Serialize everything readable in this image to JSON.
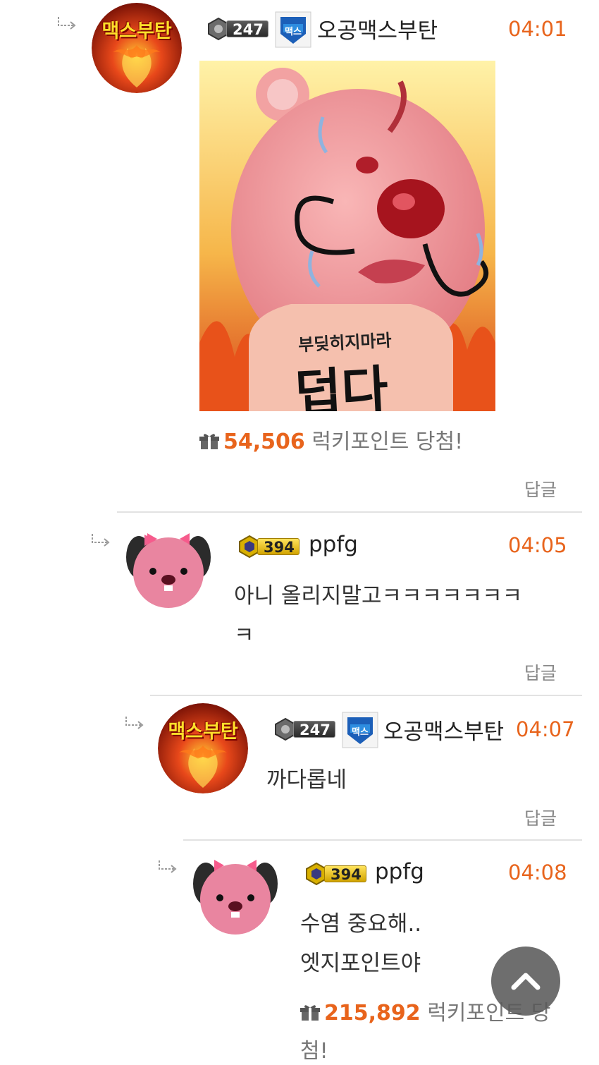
{
  "comments": [
    {
      "level": "247",
      "nickname": "오공맥스부탄",
      "time": "04:01",
      "avatar_text": "맥스부탄",
      "team_badge_text": "맥스",
      "image_caption_small": "부딪히지마라",
      "image_caption_big": "덥다",
      "lucky_amount": "54,506",
      "lucky_suffix": "럭키포인트 당첨!",
      "reply_label": "답글"
    },
    {
      "level": "394",
      "nickname": "ppfg",
      "time": "04:05",
      "text_line1": "아니 올리지말고ㅋㅋㅋㅋㅋㅋㅋ",
      "text_line2": "ㅋ",
      "reply_label": "답글"
    },
    {
      "level": "247",
      "nickname": "오공맥스부탄",
      "time": "04:07",
      "avatar_text": "맥스부탄",
      "team_badge_text": "맥스",
      "text_line1": "까다롭네",
      "reply_label": "답글"
    },
    {
      "level": "394",
      "nickname": "ppfg",
      "time": "04:08",
      "text_line1": "수염 중요해..",
      "text_line2": "엣지포인트야",
      "lucky_amount": "215,892",
      "lucky_suffix": "럭키포인트 당",
      "lucky_suffix2": "첨!"
    }
  ],
  "colors": {
    "accent": "#e8641c",
    "divider": "#e2e2e2",
    "scroll_button": "#5a5a5a"
  },
  "icons": {
    "reply_arrow": "reply-arrow-icon",
    "gift": "gift-icon",
    "scroll_top": "chevron-up-icon"
  }
}
